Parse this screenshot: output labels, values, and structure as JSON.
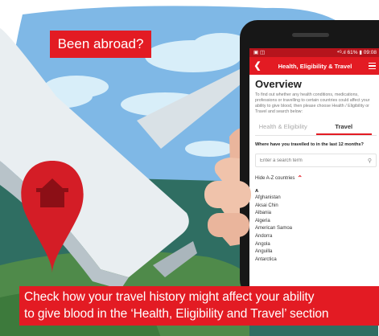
{
  "banner": {
    "top_label": "Been abroad?",
    "caption_lines": [
      "Check how your travel history might affect your ability",
      "to give blood in the ‘Health, Eligibility and Travel’ section"
    ]
  },
  "phone": {
    "status_bar": {
      "left": "▣ ◫",
      "right": "⁴ᴳ.ıl 61% ▮ 09:08"
    },
    "nav": {
      "back_icon": "chevron-left-icon",
      "title": "Health, Eligibility & Travel",
      "menu_icon": "hamburger-menu-icon"
    },
    "overview": {
      "title": "Overview",
      "text": "To find out whether any health conditions, medications, professions or travelling to certain countries could affect your ability to give blood, then please choose Health / Eligibility or Travel and search below:"
    },
    "tabs": [
      {
        "label": "Health & Eligibility",
        "active": false
      },
      {
        "label": "Travel",
        "active": true
      }
    ],
    "question": "Where have you travelled to in the last 12 months?",
    "search": {
      "placeholder": "Enter a search term",
      "icon": "search-icon"
    },
    "hide_az_label": "Hide A-Z countries",
    "countries": {
      "letter": "A",
      "items": [
        "Afghanistan",
        "Aksai Chin",
        "Albania",
        "Algeria",
        "American Samoa",
        "Andorra",
        "Angola",
        "Anguilla",
        "Antarctica"
      ]
    }
  },
  "colors": {
    "brand_red": "#e31b23",
    "sky": "#7fb8e6",
    "sea": "#2f6e62",
    "pin": "#d41d26"
  }
}
